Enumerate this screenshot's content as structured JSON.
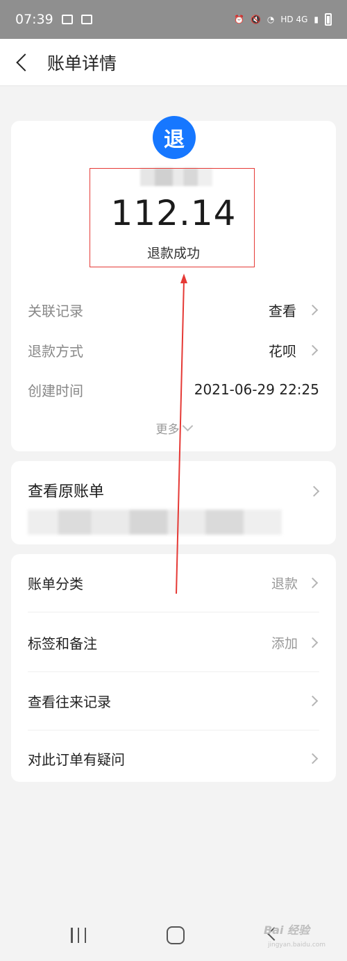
{
  "status_bar": {
    "time": "07:39",
    "network": "HD 4G"
  },
  "header": {
    "title": "账单详情"
  },
  "summary": {
    "badge_char": "退",
    "amount": "112.14",
    "status": "退款成功"
  },
  "details": [
    {
      "label": "关联记录",
      "value": "查看"
    },
    {
      "label": "退款方式",
      "value": "花呗"
    },
    {
      "label": "创建时间",
      "value": "2021-06-29 22:25"
    }
  ],
  "more_label": "更多",
  "original_bill": {
    "title": "查看原账单"
  },
  "menu": [
    {
      "label": "账单分类",
      "value": "退款"
    },
    {
      "label": "标签和备注",
      "value": "添加"
    },
    {
      "label": "查看往来记录",
      "value": ""
    },
    {
      "label": "对此订单有疑问",
      "value": ""
    }
  ],
  "watermark": {
    "logo_text": "Bai 经验",
    "domain": "jingyan.baidu.com"
  },
  "colors": {
    "accent": "#1677ff",
    "annotation": "#e53935",
    "background": "#f3f3f3"
  },
  "icons": {
    "back": "back-arrow-icon",
    "chevron": "chevron-right-icon",
    "more": "chevron-down-icon"
  }
}
